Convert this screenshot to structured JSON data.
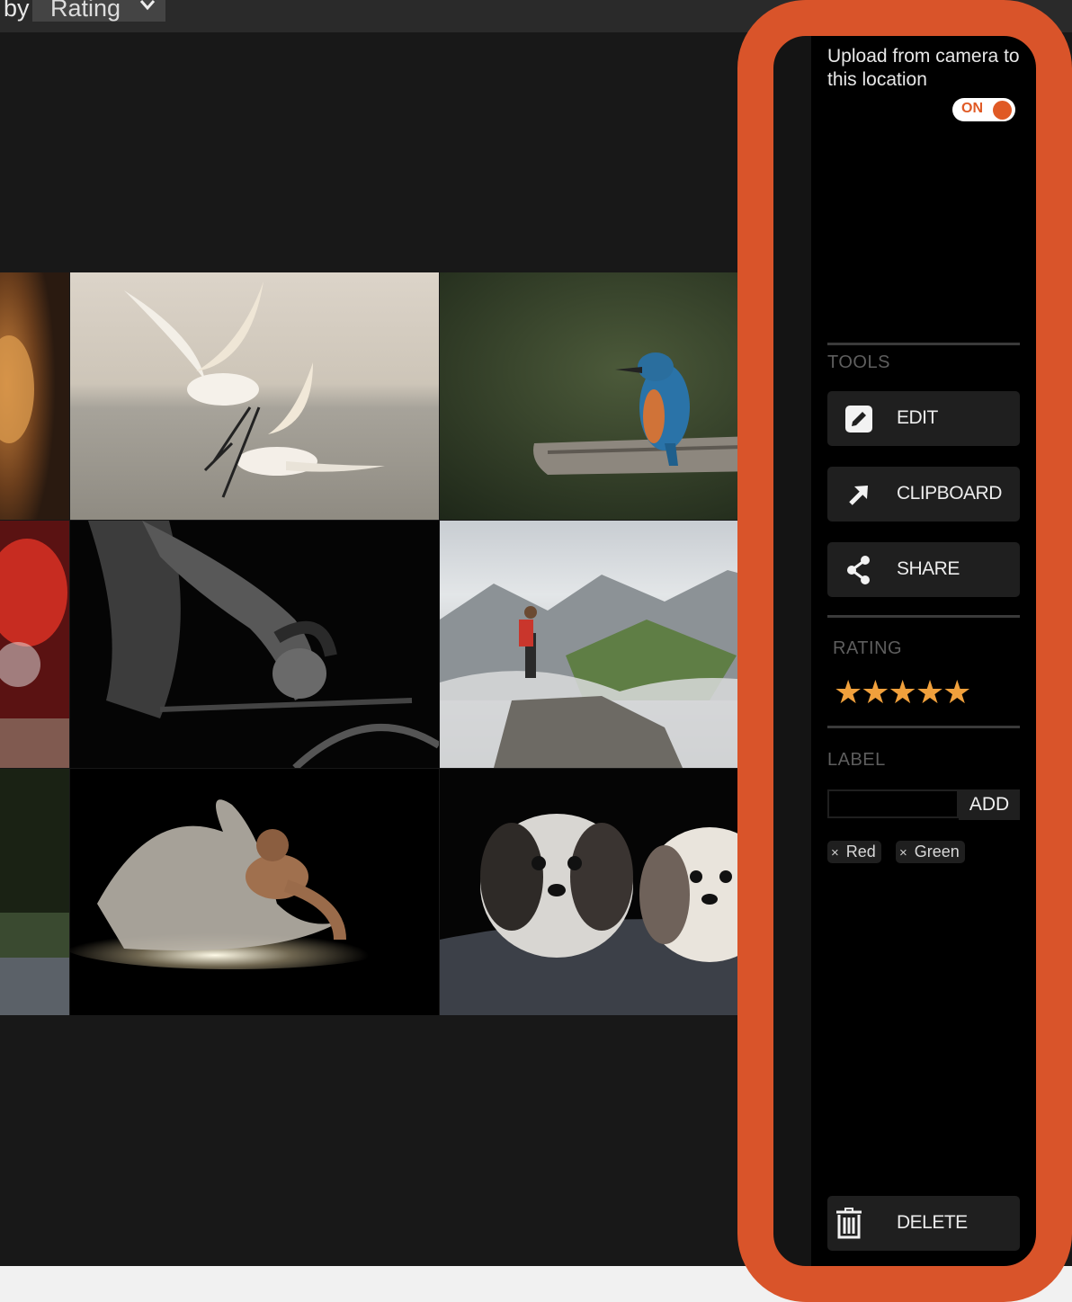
{
  "sort": {
    "prefix": "by",
    "value": "Rating"
  },
  "gallery": {
    "photos": [
      "desert-action-photo",
      "egrets-fighting-photo",
      "kingfisher-photo",
      "red-blur-photo",
      "cyclist-photo",
      "hiker-mountain-photo",
      "night-field-photo",
      "powder-dancer-photo",
      "dogs-photo"
    ]
  },
  "panel": {
    "upload_text": "Upload from camera to this location",
    "toggle_label": "ON",
    "tools_title": "TOOLS",
    "tools": [
      {
        "label": "EDIT",
        "icon": "pencil-icon"
      },
      {
        "label": "CLIPBOARD",
        "icon": "arrow-icon"
      },
      {
        "label": "SHARE",
        "icon": "share-icon"
      }
    ],
    "rating_title": "RATING",
    "rating_stars": "★★★★★",
    "rating_value": 5,
    "label_title": "LABEL",
    "label_input_value": "",
    "add_label": "ADD",
    "labels": [
      {
        "x": "×",
        "text": "Red"
      },
      {
        "x": "×",
        "text": "Green"
      }
    ],
    "delete_label": "DELETE"
  },
  "colors": {
    "accent": "#e05a25",
    "highlight": "#d9542a",
    "star": "#f0a03c"
  }
}
